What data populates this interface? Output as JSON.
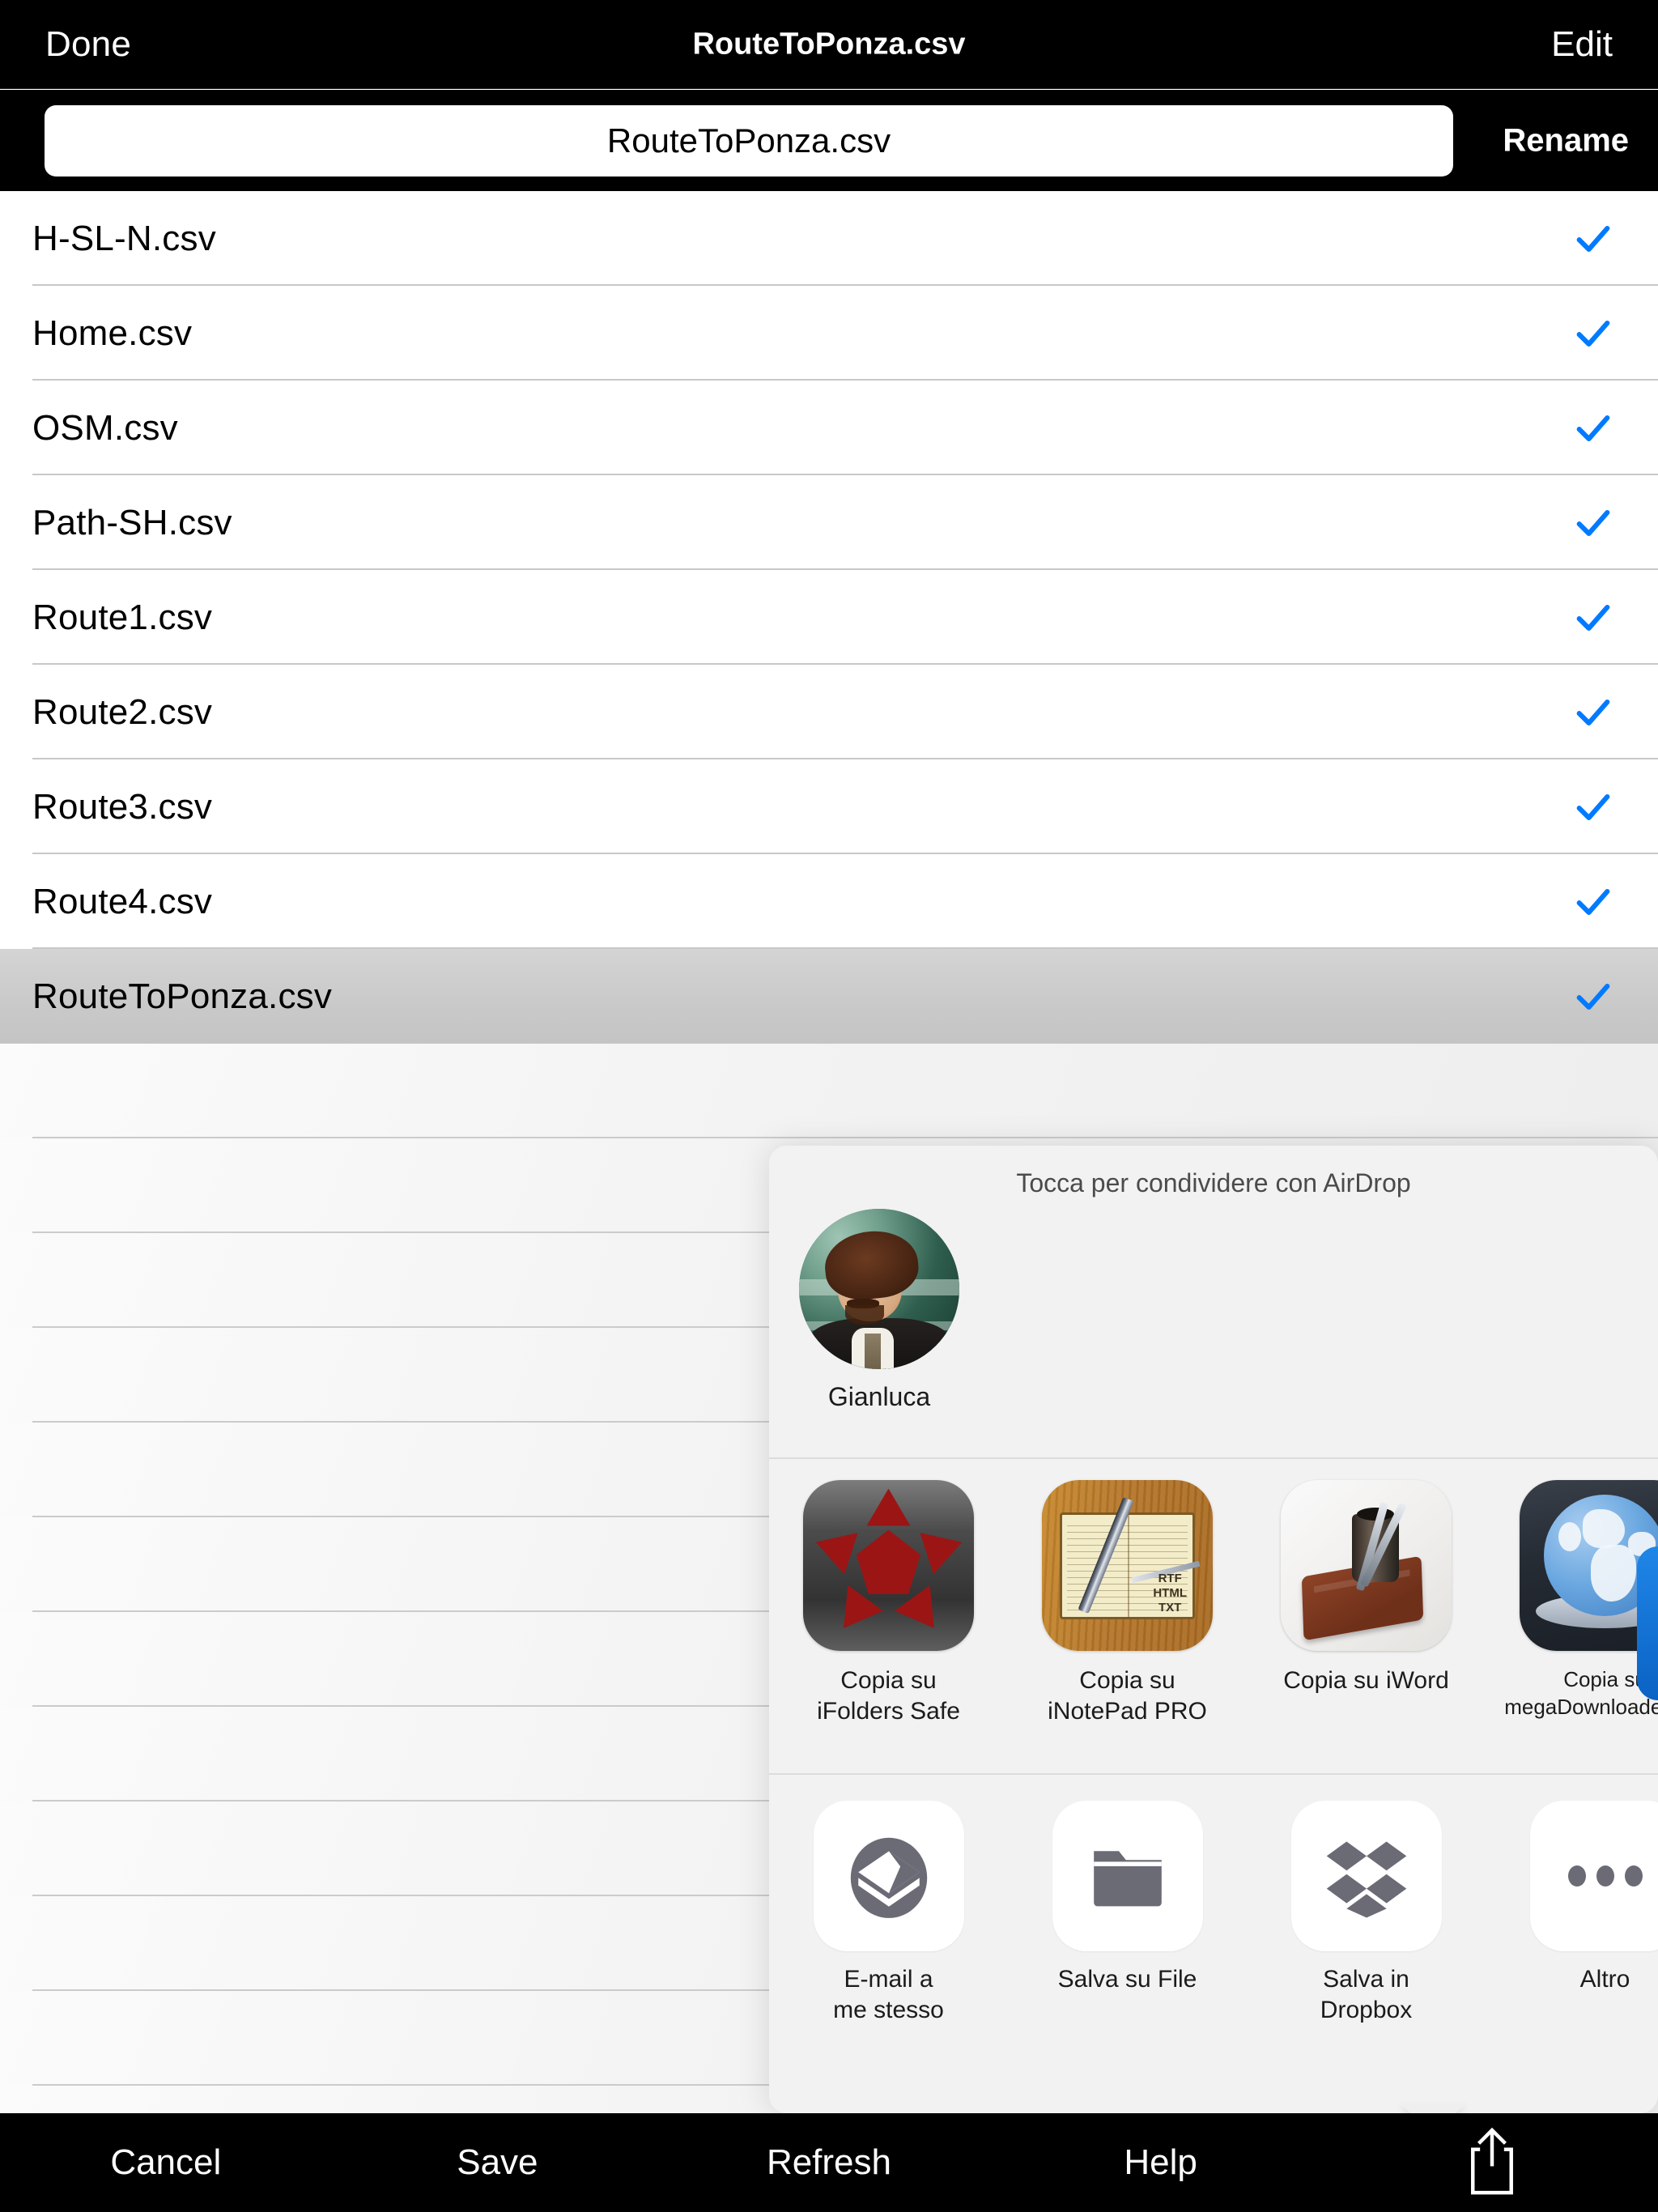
{
  "navbar": {
    "done_label": "Done",
    "title": "RouteToPonza.csv",
    "edit_label": "Edit"
  },
  "rename": {
    "value": "RouteToPonza.csv",
    "placeholder": "RouteToPonza.csv",
    "button_label": "Rename"
  },
  "files": [
    {
      "name": "H-SL-N.csv",
      "checked": true,
      "selected": false
    },
    {
      "name": "Home.csv",
      "checked": true,
      "selected": false
    },
    {
      "name": "OSM.csv",
      "checked": true,
      "selected": false
    },
    {
      "name": "Path-SH.csv",
      "checked": true,
      "selected": false
    },
    {
      "name": "Route1.csv",
      "checked": true,
      "selected": false
    },
    {
      "name": "Route2.csv",
      "checked": true,
      "selected": false
    },
    {
      "name": "Route3.csv",
      "checked": true,
      "selected": false
    },
    {
      "name": "Route4.csv",
      "checked": true,
      "selected": false
    },
    {
      "name": "RouteToPonza.csv",
      "checked": true,
      "selected": true
    }
  ],
  "share_sheet": {
    "airdrop": {
      "caption": "Tocca per condividere con AirDrop",
      "contacts": [
        {
          "name": "Gianluca",
          "avatar": "person-photo"
        }
      ]
    },
    "apps": [
      {
        "label": "Copia su\niFolders Safe",
        "icon": "ifolders-safe-icon"
      },
      {
        "label": "Copia su\niNotePad PRO",
        "icon": "inotepad-pro-icon"
      },
      {
        "label": "Copia su iWord",
        "icon": "iword-icon"
      },
      {
        "label": "Copia su\nmegaDownloader HD",
        "icon": "megadownloader-hd-icon"
      }
    ],
    "actions": [
      {
        "label": "E-mail a\nme stesso",
        "icon": "mail-icon"
      },
      {
        "label": "Salva su File",
        "icon": "folder-icon"
      },
      {
        "label": "Salva in\nDropbox",
        "icon": "dropbox-icon"
      },
      {
        "label": "Altro",
        "icon": "ellipsis-icon"
      }
    ]
  },
  "toolbar": {
    "items": [
      {
        "label": "Cancel"
      },
      {
        "label": "Save"
      },
      {
        "label": "Refresh"
      },
      {
        "label": "Help"
      }
    ],
    "share_icon": "share-icon"
  },
  "colors": {
    "accent_blue": "#007AFF",
    "bar_black": "#000000",
    "sheet_bg": "#F2F2F2",
    "selected_row": "#C9C9C9"
  }
}
